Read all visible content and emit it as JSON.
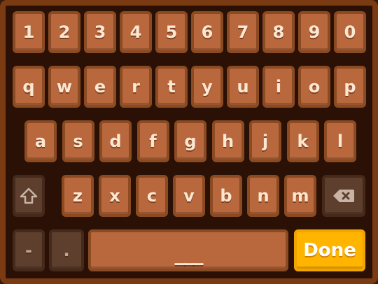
{
  "keyboard": {
    "row_numbers": [
      "1",
      "2",
      "3",
      "4",
      "5",
      "6",
      "7",
      "8",
      "9",
      "0"
    ],
    "row_top": [
      "q",
      "w",
      "e",
      "r",
      "t",
      "y",
      "u",
      "i",
      "o",
      "p"
    ],
    "row_middle": [
      "a",
      "s",
      "d",
      "f",
      "g",
      "h",
      "j",
      "k",
      "l"
    ],
    "row_bottom": [
      "z",
      "x",
      "c",
      "v",
      "b",
      "n",
      "m"
    ],
    "shift_icon": "shift-arrow-icon",
    "backspace_icon": "backspace-icon",
    "dash_label": "-",
    "period_label": ".",
    "space_label": "___",
    "done_label": "Done"
  },
  "colors": {
    "key_fill": "#b8683c",
    "key_border": "#8a4a22",
    "panel": "#2b1005",
    "frame": "#7a3a12",
    "done_fill": "#ffb400"
  }
}
